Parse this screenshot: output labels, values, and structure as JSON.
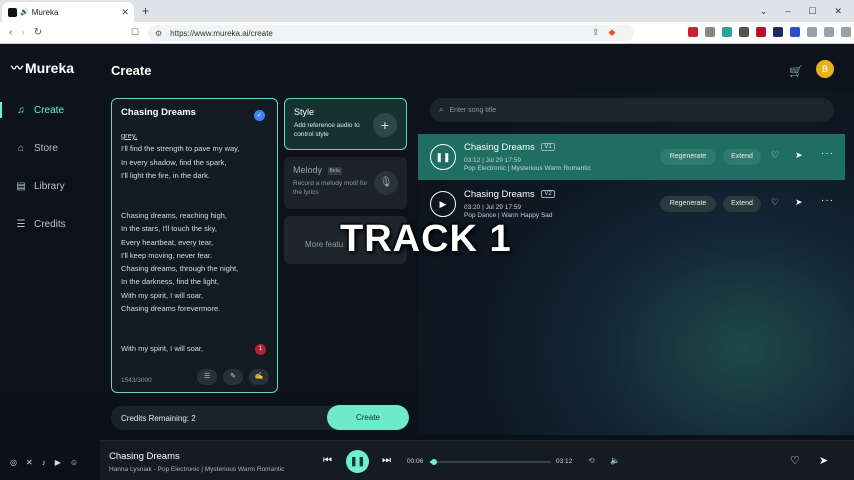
{
  "browser": {
    "tab_title": "Mureka",
    "tab_close": "✕",
    "new_tab": "+",
    "url": "https://www.mureka.ai/create",
    "win_min": "–",
    "win_max": "☐",
    "win_close": "✕",
    "win_chevron": "⌄"
  },
  "app": {
    "brand": "Mureka",
    "page_title": "Create",
    "avatar_letter": "B",
    "accent_color": "#6ef0cf"
  },
  "sidebar": {
    "items": [
      {
        "label": "Create",
        "icon": "music-note-icon"
      },
      {
        "label": "Store",
        "icon": "store-icon"
      },
      {
        "label": "Library",
        "icon": "library-icon"
      },
      {
        "label": "Credits",
        "icon": "database-icon"
      }
    ]
  },
  "lyrics": {
    "title": "Chasing Dreams",
    "first_word": "grey,",
    "verse1": [
      "I'll find the strength to pave my way,",
      "In every shadow, find the spark,",
      "I'll light the fire, in the dark."
    ],
    "chorus": [
      "Chasing dreams, reaching high,",
      "In the stars, I'll touch the sky,",
      "Every heartbeat, every tear,",
      "I'll keep moving, never fear.",
      "Chasing dreams, through the night,",
      "In the darkness, find the light,",
      "With my spirit, I will soar,",
      "Chasing dreams forevermore."
    ],
    "last_line": "With my spirit, I will soar,",
    "char_count": "1543/3000",
    "notification": "1"
  },
  "style_card": {
    "title": "Style",
    "desc": "Add reference audio to control style"
  },
  "melody_card": {
    "title": "Melody",
    "badge": "Beta",
    "desc": "Record a melody motif for the lyrics"
  },
  "more_card": {
    "label": "More featu"
  },
  "credits": {
    "label": "Credits Remaining: 2",
    "create_label": "Create"
  },
  "search": {
    "placeholder": "Enter song title"
  },
  "songs": [
    {
      "title": "Chasing Dreams",
      "version": "V1",
      "meta1": "03:12 | Jul 29 17:59",
      "meta2": "Pop Electronic | Mysterious Warm Romantic",
      "regenerate": "Regenerate",
      "extend": "Extend"
    },
    {
      "title": "Chasing Dreams",
      "version": "V2",
      "meta1": "03:20 | Jul 29 17:59",
      "meta2": "Pop Dance | Warm Happy Sad",
      "regenerate": "Regenerate",
      "extend": "Extend"
    }
  ],
  "overlay": {
    "text": "TRACK 1"
  },
  "player": {
    "title": "Chasing Dreams",
    "subtitle": "Hanna Lysniak - Pop Electronic | Mysterious Warm Romantic",
    "current_time": "00:06",
    "duration": "03:12",
    "progress": 0.03
  }
}
